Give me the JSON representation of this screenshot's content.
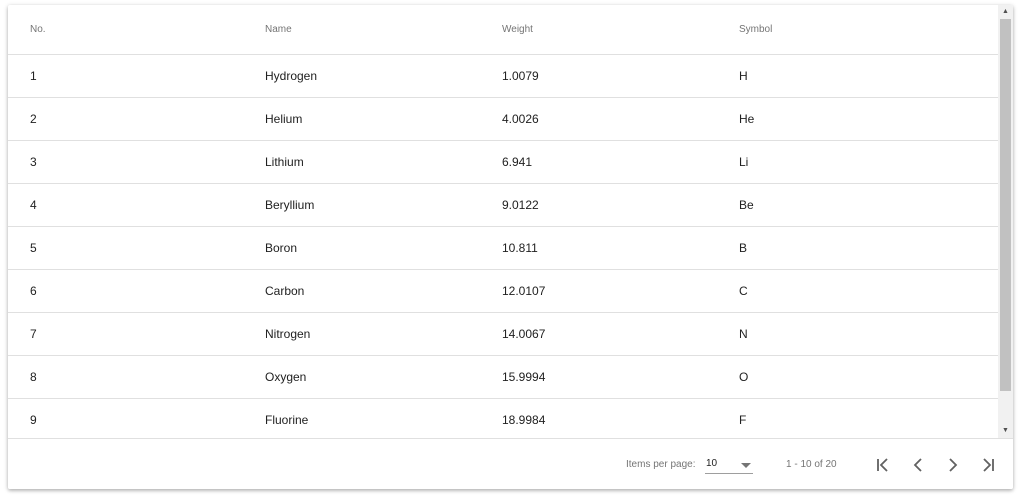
{
  "table": {
    "headers": [
      "No.",
      "Name",
      "Weight",
      "Symbol"
    ],
    "rows": [
      [
        "1",
        "Hydrogen",
        "1.0079",
        "H"
      ],
      [
        "2",
        "Helium",
        "4.0026",
        "He"
      ],
      [
        "3",
        "Lithium",
        "6.941",
        "Li"
      ],
      [
        "4",
        "Beryllium",
        "9.0122",
        "Be"
      ],
      [
        "5",
        "Boron",
        "10.811",
        "B"
      ],
      [
        "6",
        "Carbon",
        "12.0107",
        "C"
      ],
      [
        "7",
        "Nitrogen",
        "14.0067",
        "N"
      ],
      [
        "8",
        "Oxygen",
        "15.9994",
        "O"
      ],
      [
        "9",
        "Fluorine",
        "18.9984",
        "F"
      ]
    ]
  },
  "paginator": {
    "items_per_page_label": "Items per page:",
    "page_size": "10",
    "range_label": "1 - 10 of 20",
    "icons": {
      "first": "first-page-icon",
      "prev": "chevron-left-icon",
      "next": "chevron-right-icon",
      "last": "last-page-icon"
    }
  },
  "colors": {
    "header_text": "#757575",
    "cell_text": "#212121",
    "divider": "#e0e0e0",
    "scroll_thumb": "#c1c1c1"
  }
}
